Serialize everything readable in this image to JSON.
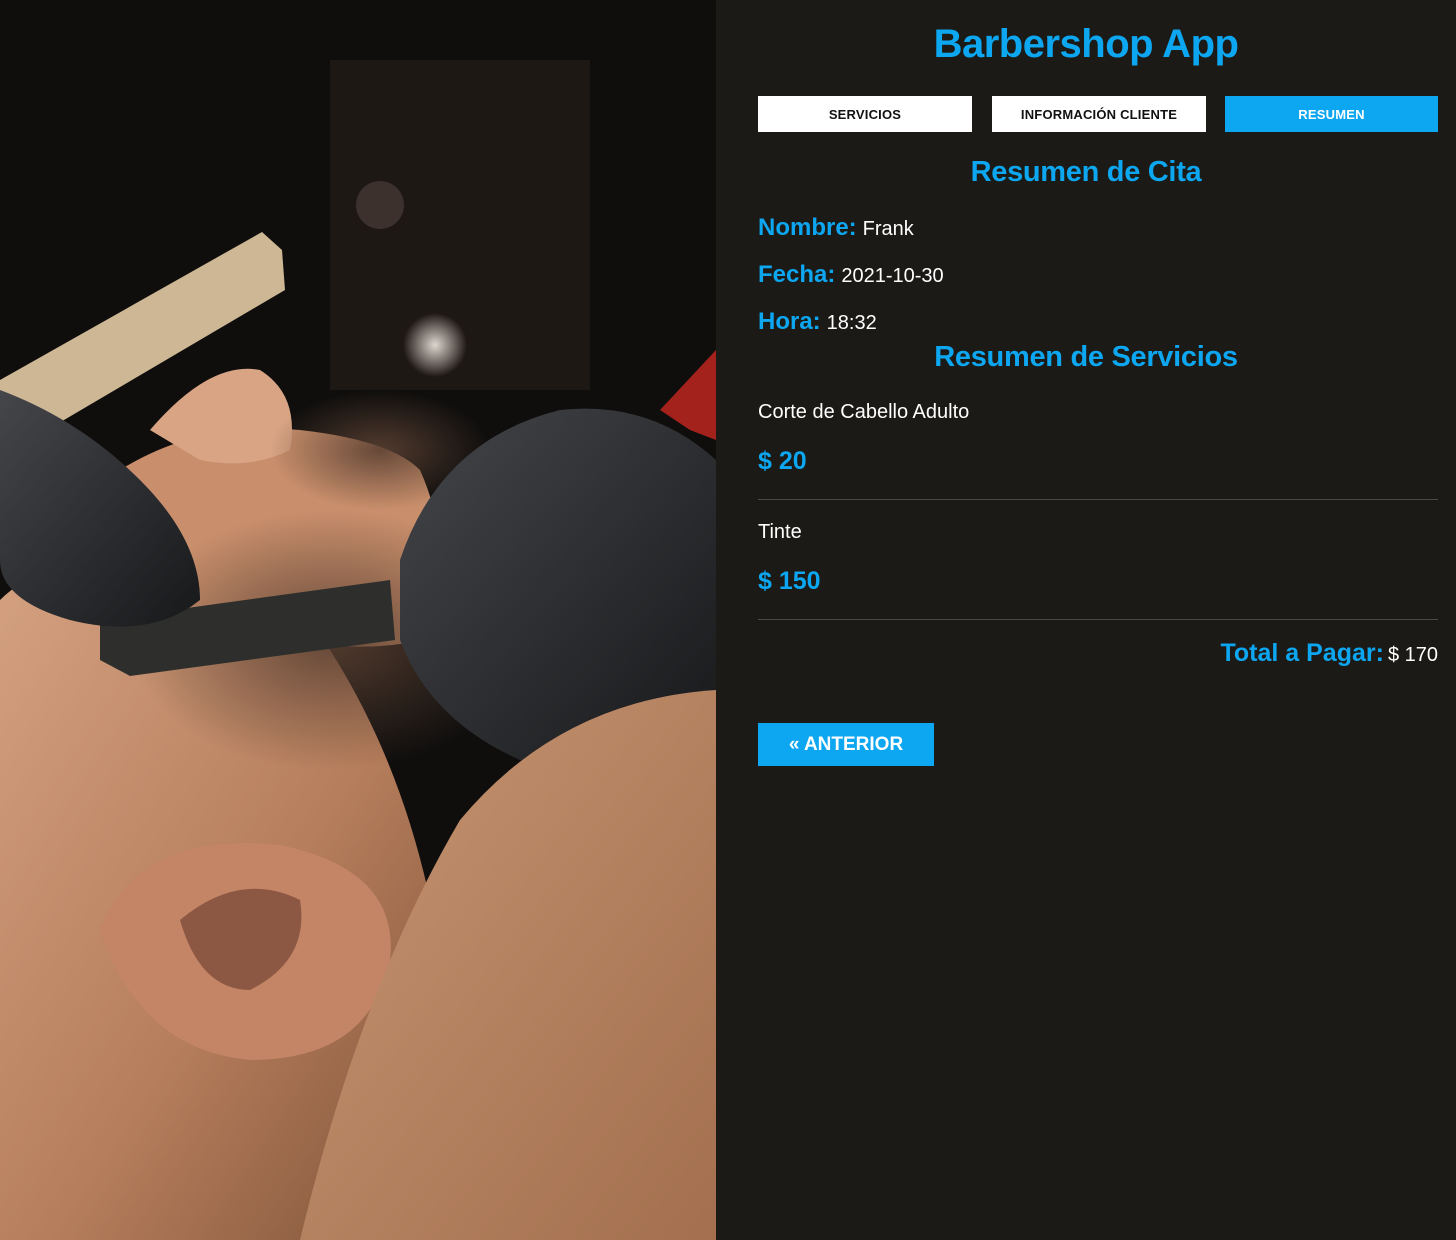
{
  "app": {
    "title": "Barbershop App"
  },
  "tabs": [
    {
      "label": "SERVICIOS",
      "active": false
    },
    {
      "label": "INFORMACIÓN CLIENTE",
      "active": false
    },
    {
      "label": "RESUMEN",
      "active": true
    }
  ],
  "summary": {
    "heading": "Resumen de Cita",
    "nombre_label": "Nombre:",
    "nombre_value": "Frank",
    "fecha_label": "Fecha:",
    "fecha_value": "2021-10-30",
    "hora_label": "Hora:",
    "hora_value": "18:32"
  },
  "services": {
    "heading": "Resumen de Servicios",
    "items": [
      {
        "name": "Corte de Cabello Adulto",
        "price": "$ 20"
      },
      {
        "name": "Tinte",
        "price": "$ 150"
      }
    ],
    "total_label": "Total a Pagar:",
    "total_value": "$ 170"
  },
  "buttons": {
    "previous": "« ANTERIOR"
  },
  "colors": {
    "accent": "#0da6f0",
    "background": "#1b1a16",
    "text": "#ffffff"
  },
  "hero_image": {
    "icon": "barber-shaving-photo"
  }
}
